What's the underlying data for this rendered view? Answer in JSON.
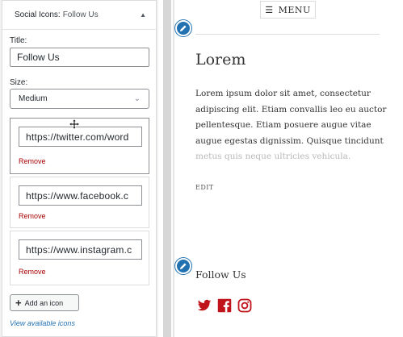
{
  "widget": {
    "header_prefix": "Social Icons:",
    "header_title": "Follow Us",
    "title_label": "Title:",
    "title_value": "Follow Us",
    "size_label": "Size:",
    "size_value": "Medium",
    "icons": [
      {
        "url": "https://twitter.com/word",
        "remove": "Remove"
      },
      {
        "url": "https://www.facebook.c",
        "remove": "Remove"
      },
      {
        "url": "https://www.instagram.c",
        "remove": "Remove"
      }
    ],
    "add_icon_label": "Add an icon",
    "view_available_label": "View available icons"
  },
  "preview": {
    "menu_label": "MENU",
    "post_title": "Lorem",
    "post_body_visible": "Lorem ipsum dolor sit amet, consectetur adipiscing elit. Etiam convallis leo eu auctor pellentesque. Etiam posuere augue vitae augue egestas dignissim. Quisque tincidunt",
    "post_body_faded": "metus quis neque ultricies vehicula.",
    "edit_label": "EDIT",
    "widget_title": "Follow Us",
    "social_icons": [
      "twitter-icon",
      "facebook-icon",
      "instagram-icon"
    ],
    "social_color": "#c0131a",
    "accent": "#2271b1"
  }
}
